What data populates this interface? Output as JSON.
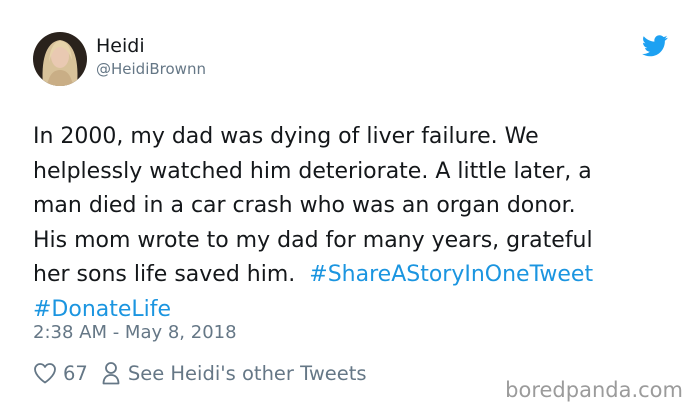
{
  "author": {
    "display_name": "Heidi",
    "handle": "@HeidiBrownn"
  },
  "tweet": {
    "lines": [
      "In 2000, my dad was dying of liver failure. We",
      "helplessly watched him deteriorate. A little later, a",
      "man died in a car crash who was an organ donor.",
      "His mom wrote to my dad for many years, grateful",
      "her sons life saved him."
    ],
    "hashtags": [
      "#ShareAStoryInOneTweet",
      "#DonateLife"
    ],
    "timestamp": "2:38 AM - May 8, 2018"
  },
  "actions": {
    "like_count": "67",
    "see_more": "See Heidi's other Tweets"
  },
  "watermark": "boredpanda.com",
  "colors": {
    "link": "#1b95e0",
    "muted": "#657786",
    "text": "#14171a"
  },
  "icons": {
    "brand": "twitter-bird-icon",
    "like": "heart-icon",
    "profile": "person-icon"
  }
}
